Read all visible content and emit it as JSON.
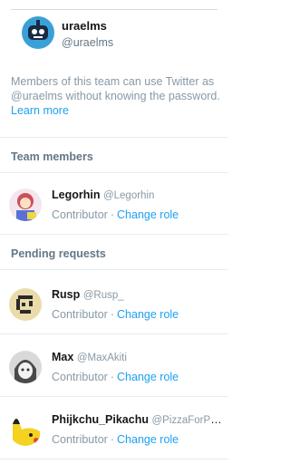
{
  "team": {
    "name": "uraelms",
    "handle": "@uraelms",
    "info_text": "Members of this team can use Twitter as @uraelms without knowing the password.",
    "learn_more": "Learn more"
  },
  "sections": {
    "team_members_title": "Team members",
    "pending_title": "Pending requests"
  },
  "team_members": [
    {
      "name": "Legorhin",
      "handle": "@Legorhin",
      "role": "Contributor",
      "action": "Change role"
    }
  ],
  "pending_requests": [
    {
      "name": "Rusp",
      "handle": "@Rusp_",
      "role": "Contributor",
      "action": "Change role"
    },
    {
      "name": "Max",
      "handle": "@MaxAkiti",
      "role": "Contributor",
      "action": "Change role"
    },
    {
      "name": "Phijkchu_Pikachu",
      "handle": "@PizzaForPikachu",
      "role": "Contributor",
      "action": "Change role"
    }
  ],
  "separator": "·",
  "colors": {
    "link": "#1da1f2",
    "muted": "#8899a6",
    "text": "#14171a"
  },
  "icons": {
    "team_avatar": "robot-avatar-icon"
  }
}
